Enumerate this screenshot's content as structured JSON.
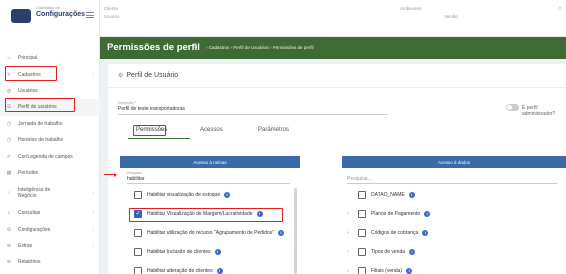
{
  "app": {
    "logo_subtitle": "Cadastros de",
    "logo_title": "Configurações"
  },
  "topbar": {
    "client_label": "Cliente",
    "user_label": "Usuário",
    "environment_label": "Ambientes",
    "version_label": "Versão"
  },
  "sidebar": {
    "items": [
      {
        "label": "Principal",
        "icon": "home-icon",
        "glyph": "⌂",
        "expandable": false
      },
      {
        "label": "Cadastros",
        "icon": "edit-icon",
        "glyph": "✎",
        "expandable": true
      },
      {
        "label": "Usuários",
        "icon": "users-icon",
        "glyph": "◍",
        "expandable": false
      },
      {
        "label": "Perfil de usuários",
        "icon": "list-icon",
        "glyph": "☰",
        "expandable": false
      },
      {
        "label": "Jornada de trabalho",
        "icon": "clock-icon",
        "glyph": "◷",
        "expandable": false
      },
      {
        "label": "Horários de trabalho",
        "icon": "clock-icon",
        "glyph": "◷",
        "expandable": false
      },
      {
        "label": "Cor/Legenda de campos",
        "icon": "brush-icon",
        "glyph": "✐",
        "expandable": false
      },
      {
        "label": "Períodos",
        "icon": "calendar-icon",
        "glyph": "▦",
        "expandable": false
      },
      {
        "label": "Inteligência de Negócio",
        "icon": "bulb-icon",
        "glyph": "♁",
        "expandable": true
      },
      {
        "label": "Consultas",
        "icon": "search-icon",
        "glyph": "⌕",
        "expandable": true
      },
      {
        "label": "Configurações",
        "icon": "gear-icon",
        "glyph": "⚙",
        "expandable": true
      },
      {
        "label": "Extras",
        "icon": "plus-icon",
        "glyph": "⊕",
        "expandable": true
      },
      {
        "label": "Relatórios",
        "icon": "report-icon",
        "glyph": "⊛",
        "expandable": false
      }
    ]
  },
  "header": {
    "page_title": "Permissões de perfil",
    "breadcrumb": "› Cadastros › Perfil de Usuários › Permissões de perfil"
  },
  "card": {
    "title": "Perfil de Usuário",
    "description_label": "Descrição *",
    "description_value": "Perfil de teste transportadoras",
    "admin_toggle_label": "É perfil administrador?",
    "tabs": [
      {
        "label": "Permissões"
      },
      {
        "label": "Acessos"
      },
      {
        "label": "Parâmetros"
      }
    ]
  },
  "rotinas": {
    "header": "Acesso à rotinas",
    "search_label": "Pesquisa",
    "search_value": "habilitar",
    "items": [
      {
        "label": "Habilitar visualização de estoque",
        "checked": false
      },
      {
        "label": "Habilitar Visualização de Margem/Lucratividade",
        "checked": true
      },
      {
        "label": "Habilitar utilização do recurso \"Agrupamento de Pedidos\"",
        "checked": false
      },
      {
        "label": "Habilitar Inclusão de clientes",
        "checked": false
      },
      {
        "label": "Habilitar alteração de clientes",
        "checked": false
      }
    ]
  },
  "dados": {
    "header": "Acesso à dados",
    "search_placeholder": "Pesquisa...",
    "items": [
      {
        "label": "DATAO_NAME",
        "expandable": false
      },
      {
        "label": "Planos de Pagamento",
        "expandable": true
      },
      {
        "label": "Códigos de cobrança",
        "expandable": true
      },
      {
        "label": "Tipos de venda",
        "expandable": true
      },
      {
        "label": "Filiais (venda)",
        "expandable": true
      }
    ]
  }
}
